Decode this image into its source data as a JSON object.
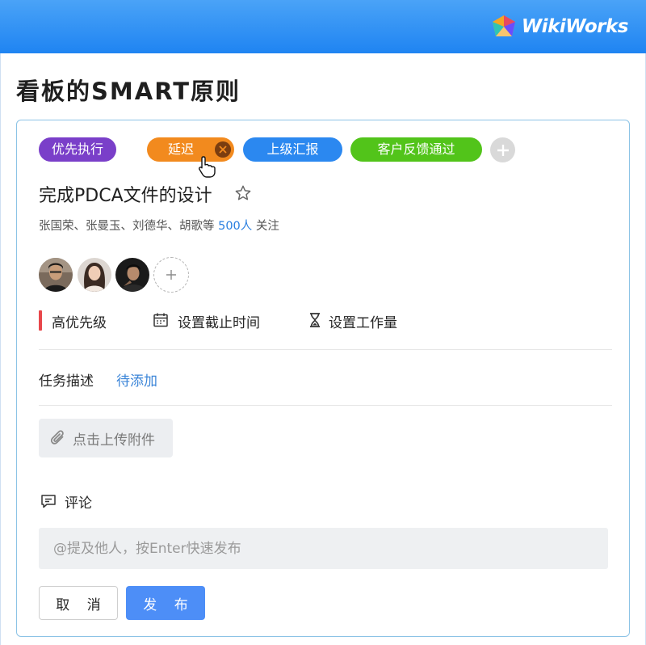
{
  "app": {
    "brand": "WikiWorks"
  },
  "page": {
    "title": "看板的SMART原则"
  },
  "tags": [
    {
      "label": "优先执行",
      "color": "#7a3fc9"
    },
    {
      "label": "延迟",
      "color": "#f28a1e"
    },
    {
      "label": "上级汇报",
      "color": "#2b88f0"
    },
    {
      "label": "客户反馈通过",
      "color": "#52c41a"
    }
  ],
  "task": {
    "title": "完成PDCA文件的设计",
    "followers": "张国荣、张曼玉、刘德华、胡歌等",
    "follow_count": "500人",
    "follow_suffix": "关注",
    "priority": "高优先级",
    "deadline": "设置截止时间",
    "workload": "设置工作量",
    "description_label": "任务描述",
    "description_value": "待添加",
    "upload": "点击上传附件"
  },
  "comment": {
    "label": "评论",
    "placeholder": "@提及他人，按Enter快速发布"
  },
  "buttons": {
    "cancel": "取 消",
    "publish": "发 布"
  },
  "icons": [
    "close-icon",
    "plus-icon",
    "star-icon",
    "calendar-icon",
    "hourglass-icon",
    "paperclip-icon",
    "comment-icon",
    "hand-cursor-icon"
  ]
}
